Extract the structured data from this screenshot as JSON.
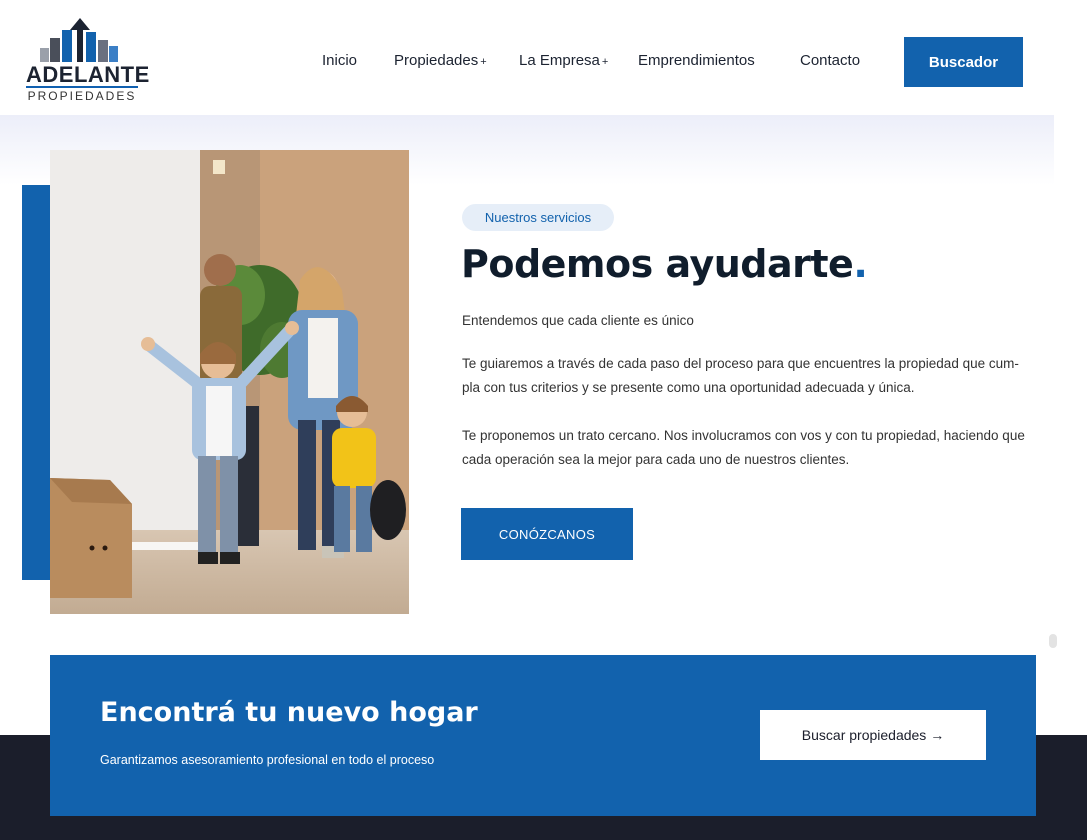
{
  "header": {
    "logo": {
      "word": "ADELANTE",
      "sub": "PROPIEDADES"
    },
    "nav": [
      {
        "label": "Inicio",
        "has_plus": false
      },
      {
        "label": "Propiedades",
        "has_plus": true
      },
      {
        "label": "La Empresa",
        "has_plus": true
      },
      {
        "label": "Emprendimientos",
        "has_plus": false
      },
      {
        "label": "Contacto",
        "has_plus": false
      }
    ],
    "plus_symbol": "+",
    "cta_label": "Buscador"
  },
  "hero": {
    "badge": "Nuestros servicios",
    "title": "Podemos ayudarte",
    "title_dot": ".",
    "intro": "Entendemos que cada cliente es único",
    "paragraph_1_line_1": "Te guiaremos a través de cada paso del proceso para que encuentres la propiedad que cum-",
    "paragraph_1_line_2": "pla con tus criterios y se presente como una oportunidad adecuada y única.",
    "paragraph_2_line_1": "Te proponemos un trato cercano. Nos involucramos con vos y con tu propiedad, haciendo que",
    "paragraph_2_line_2": "cada operación sea la mejor para cada uno de nuestros clientes.",
    "button": "CONÓZCANOS"
  },
  "cta_banner": {
    "title": "Encontrá tu nuevo hogar",
    "subtitle": "Garantizamos asesoramiento profesional en todo el proceso",
    "button": "Buscar propiedades →"
  },
  "colors": {
    "brand_blue": "#1262ad",
    "dark": "#1b1e2b",
    "heading": "#101d2c"
  }
}
